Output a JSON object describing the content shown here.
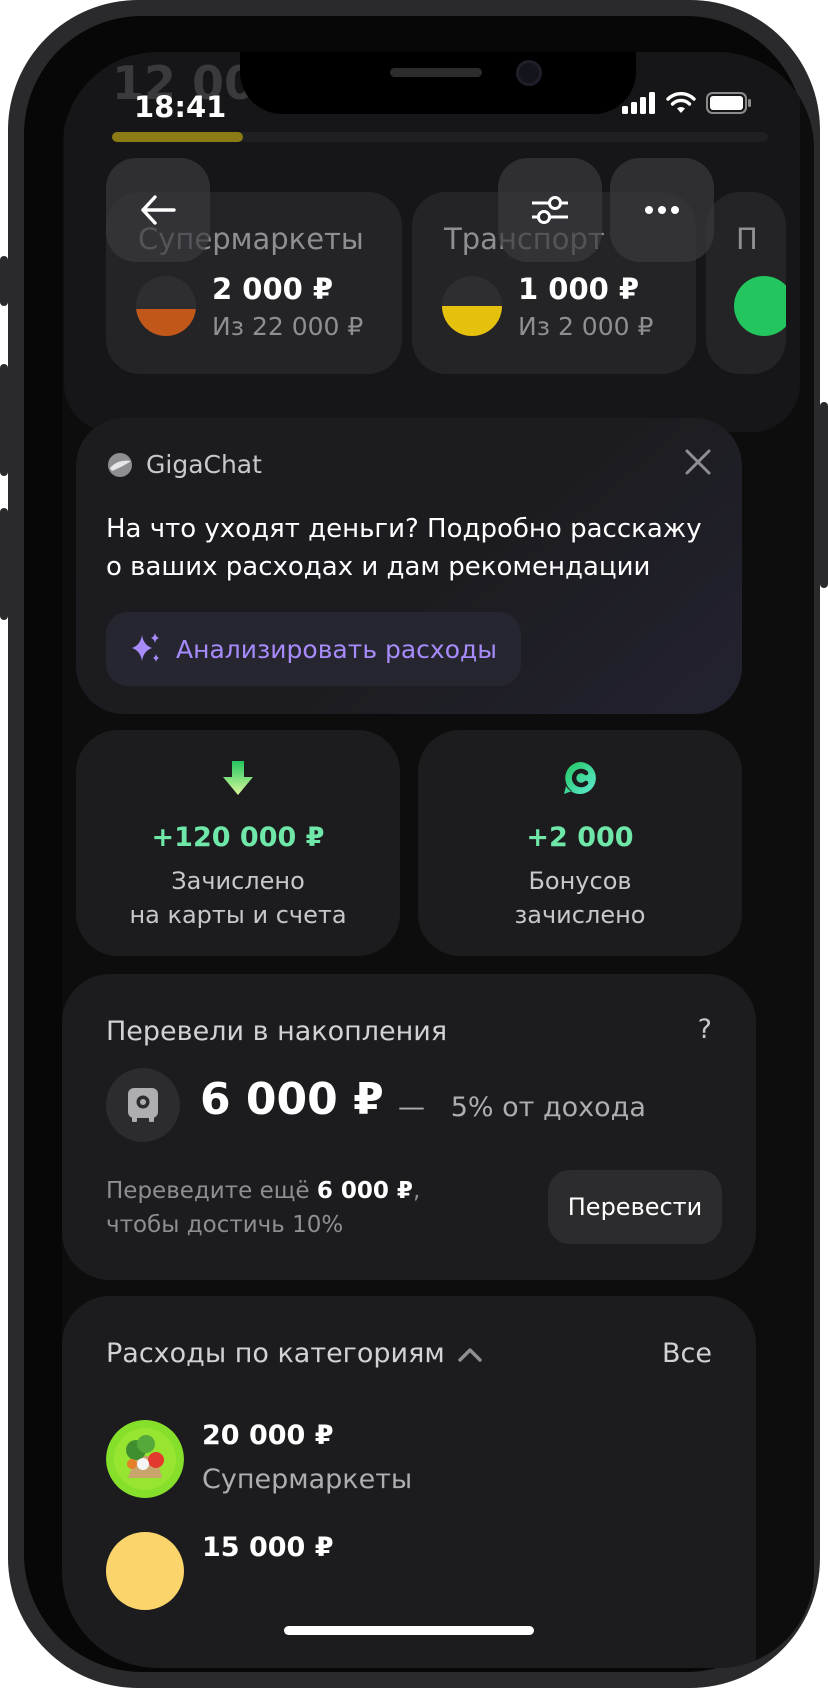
{
  "status_bar": {
    "time": "18:41",
    "ghost_amount": "12 000"
  },
  "budget_progress": {
    "fraction": 0.2,
    "color": "#8a7b16"
  },
  "budgets": [
    {
      "title": "Супермаркеты",
      "amount": "2 000 ₽",
      "limit": "Из 22 000 ₽",
      "fill_fraction": 0.45,
      "color": "#c2571a"
    },
    {
      "title": "Транспорт",
      "amount": "1 000 ₽",
      "limit": "Из 2 000 ₽",
      "fill_fraction": 0.5,
      "color": "#e5c00c"
    },
    {
      "title": "П",
      "color": "#22c55e"
    }
  ],
  "gigachat": {
    "name": "GigaChat",
    "text": "На что уходят деньги? Подробно расскажу о ваших расходах и дам рекомендации",
    "button": "Анализировать расходы",
    "accent": "#a78bfa"
  },
  "tiles": {
    "credited": {
      "amount": "+120 000 ₽",
      "label_line1": "Зачислено",
      "label_line2": "на карты и счета"
    },
    "bonuses": {
      "amount": "+2 000",
      "label_line1": "Бонусов",
      "label_line2": "зачислено"
    },
    "accent": "#6ee7a8"
  },
  "savings": {
    "title": "Перевели в накопления",
    "help": "?",
    "amount": "6 000 ₽",
    "separator": "—",
    "percent_text": "5% от дохода",
    "hint_prefix": "Переведите ещё",
    "hint_amount": "6 000 ₽",
    "hint_suffix": ",",
    "hint_line2": "чтобы достичь 10%",
    "button": "Перевести"
  },
  "categories": {
    "title": "Расходы по категориям",
    "all": "Все",
    "items": [
      {
        "amount": "20 000 ₽",
        "name": "Супермаркеты"
      },
      {
        "amount": "15 000 ₽"
      }
    ]
  }
}
